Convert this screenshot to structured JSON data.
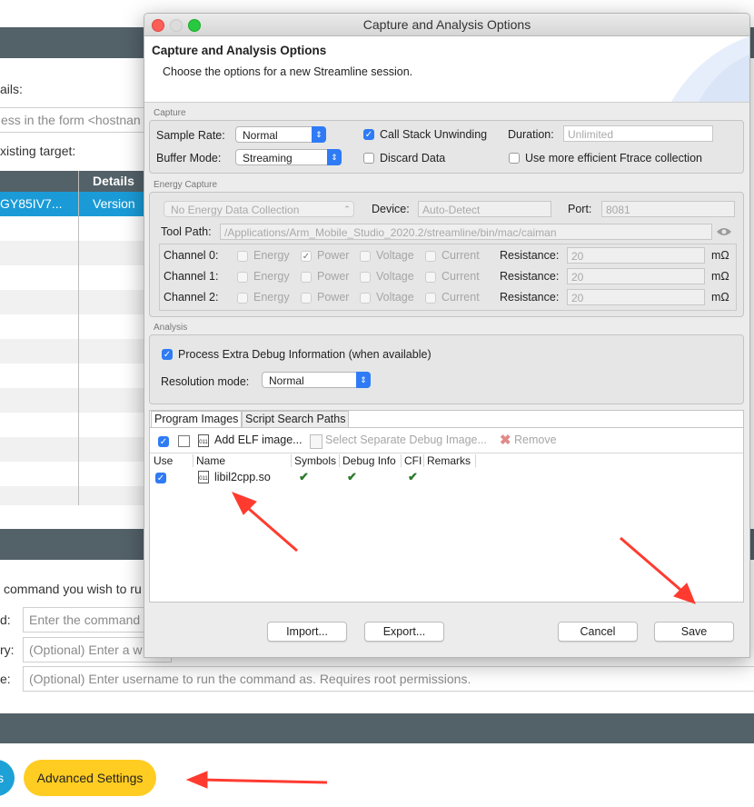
{
  "background": {
    "details_label": "ails:",
    "host_placeholder": "ess in the form <hostnan",
    "existing_target_label": "xisting target:",
    "table": {
      "details_header": "Details",
      "selected_row": [
        "GY85IV7...",
        "Version"
      ]
    },
    "command_prompt": " command you wish to ru",
    "command_label": "d:",
    "command_placeholder": "Enter the command",
    "dir_label": "ry:",
    "dir_placeholder": "(Optional) Enter a w",
    "user_label": "e:",
    "user_placeholder": "(Optional) Enter username to run the command as. Requires root permissions.",
    "left_button": "s",
    "advanced_button": "Advanced Settings"
  },
  "dialog": {
    "title": "Capture and Analysis Options",
    "header_title": "Capture and Analysis Options",
    "header_subtitle": "Choose the options for a new Streamline session.",
    "capture": {
      "group": "Capture",
      "sample_rate_label": "Sample Rate:",
      "sample_rate": "Normal",
      "call_stack": "Call Stack Unwinding",
      "duration_label": "Duration:",
      "duration_placeholder": "Unlimited",
      "buffer_mode_label": "Buffer Mode:",
      "buffer_mode": "Streaming",
      "discard_data": "Discard Data",
      "ftrace": "Use more efficient Ftrace collection"
    },
    "energy": {
      "group": "Energy Capture",
      "source": "No Energy Data Collection",
      "device_label": "Device:",
      "device": "Auto-Detect",
      "port_label": "Port:",
      "port": "8081",
      "tool_path_label": "Tool Path:",
      "tool_path": "/Applications/Arm_Mobile_Studio_2020.2/streamline/bin/mac/caiman",
      "channels": [
        {
          "label": "Channel 0:",
          "energy": "Energy",
          "power": "Power",
          "voltage": "Voltage",
          "current": "Current",
          "res_label": "Resistance:",
          "res": "20",
          "unit": "mΩ"
        },
        {
          "label": "Channel 1:",
          "energy": "Energy",
          "power": "Power",
          "voltage": "Voltage",
          "current": "Current",
          "res_label": "Resistance:",
          "res": "20",
          "unit": "mΩ"
        },
        {
          "label": "Channel 2:",
          "energy": "Energy",
          "power": "Power",
          "voltage": "Voltage",
          "current": "Current",
          "res_label": "Resistance:",
          "res": "20",
          "unit": "mΩ"
        }
      ]
    },
    "analysis": {
      "group": "Analysis",
      "process_debug": "Process Extra Debug Information (when available)",
      "resolution_label": "Resolution mode:",
      "resolution": "Normal"
    },
    "images": {
      "tabs": [
        "Program Images",
        "Script Search Paths"
      ],
      "add_elf": "Add ELF image...",
      "select_debug": "Select Separate Debug Image...",
      "remove": "Remove",
      "columns": [
        "Use",
        "Name",
        "Symbols",
        "Debug Info",
        "CFI",
        "Remarks"
      ],
      "rows": [
        {
          "name": "libil2cpp.so"
        }
      ]
    },
    "buttons": {
      "import": "Import...",
      "export": "Export...",
      "cancel": "Cancel",
      "save": "Save"
    }
  },
  "colors": {
    "accent": "#2f7bf5",
    "annotation_arrow": "#ff3b30",
    "advanced_button": "#ffcc22",
    "left_button": "#1da1d6",
    "dark_bar": "#536169",
    "selected_row": "#1a9bd7"
  }
}
